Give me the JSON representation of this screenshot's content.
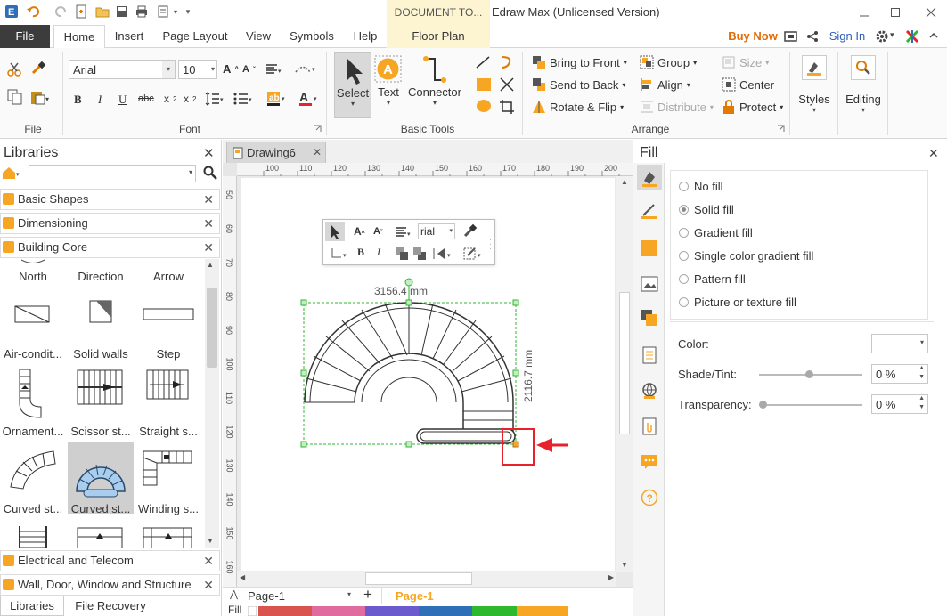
{
  "app": {
    "title": "Edraw Max (Unlicensed Version)",
    "context_tab": "DOCUMENT TO..."
  },
  "menu": {
    "file": "File",
    "tabs": [
      "Home",
      "Insert",
      "Page Layout",
      "View",
      "Symbols",
      "Help"
    ],
    "floor_plan": "Floor Plan",
    "buy_now": "Buy Now",
    "sign_in": "Sign In"
  },
  "ribbon": {
    "font_name": "Arial",
    "font_size": "10",
    "groups": {
      "file": "File",
      "font": "Font",
      "basic_tools": "Basic Tools",
      "arrange": "Arrange"
    },
    "tools": {
      "select": "Select",
      "text": "Text",
      "connector": "Connector"
    },
    "arrange": {
      "bring_to_front": "Bring to Front",
      "send_to_back": "Send to Back",
      "rotate_flip": "Rotate & Flip",
      "group": "Group",
      "align": "Align",
      "distribute": "Distribute",
      "size": "Size",
      "center": "Center",
      "protect": "Protect"
    },
    "styles": "Styles",
    "editing": "Editing"
  },
  "libraries": {
    "title": "Libraries",
    "sections": [
      "Basic Shapes",
      "Dimensioning",
      "Building Core"
    ],
    "bottom_sections": [
      "Electrical and Telecom",
      "Wall, Door, Window and Structure"
    ],
    "shapes": [
      [
        "North",
        "Direction",
        "Arrow"
      ],
      [
        "Air-condit...",
        "Solid walls",
        "Step"
      ],
      [
        "Ornament...",
        "Scissor st...",
        "Straight s..."
      ],
      [
        "Curved st...",
        "Curved st...",
        "Winding s..."
      ]
    ],
    "bottom_tabs": [
      "Libraries",
      "File Recovery"
    ]
  },
  "document": {
    "tab": "Drawing6",
    "ruler_h": [
      "100",
      "110",
      "120",
      "130",
      "140",
      "150",
      "160",
      "170",
      "180",
      "190",
      "200"
    ],
    "ruler_v": [
      "50",
      "60",
      "70",
      "80",
      "90",
      "100",
      "110",
      "120",
      "130",
      "140",
      "150",
      "160"
    ],
    "dim_width": "3156.4 mm",
    "dim_height": "2116.7 mm",
    "mini_font": "rial"
  },
  "fill_panel": {
    "title": "Fill",
    "options": [
      "No fill",
      "Solid fill",
      "Gradient fill",
      "Single color gradient fill",
      "Pattern fill",
      "Picture or texture fill"
    ],
    "selected": "Solid fill",
    "color_label": "Color:",
    "shade_label": "Shade/Tint:",
    "shade_value": "0 %",
    "transparency_label": "Transparency:",
    "transparency_value": "0 %"
  },
  "pages": {
    "current": "Page-1",
    "tab": "Page-1",
    "fill_label": "Fill"
  },
  "colors": {
    "accent_orange": "#f6a623",
    "buy_now": "#e36c09",
    "sign_in": "#2f5fb3",
    "selection_green": "#2db82d",
    "annotation_red": "#e8212a"
  }
}
